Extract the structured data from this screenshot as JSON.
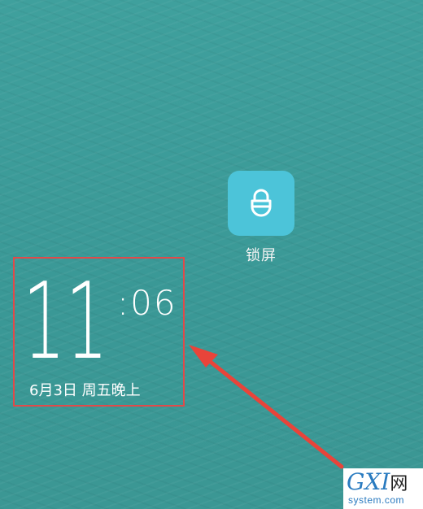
{
  "wallpaper": {
    "color": "#3f9c9a"
  },
  "app": {
    "label": "锁屏",
    "icon": "padlock-icon",
    "tile_color": "#4cc4d9"
  },
  "clock": {
    "hours": "11",
    "minutes": ":06",
    "date": "6月3日  周五晚上"
  },
  "annotation": {
    "box_color": "#e04a4a",
    "arrow_color": "#e8443a"
  },
  "watermark": {
    "logo": "GXI",
    "logo_cn": "网",
    "site": "system.com"
  }
}
